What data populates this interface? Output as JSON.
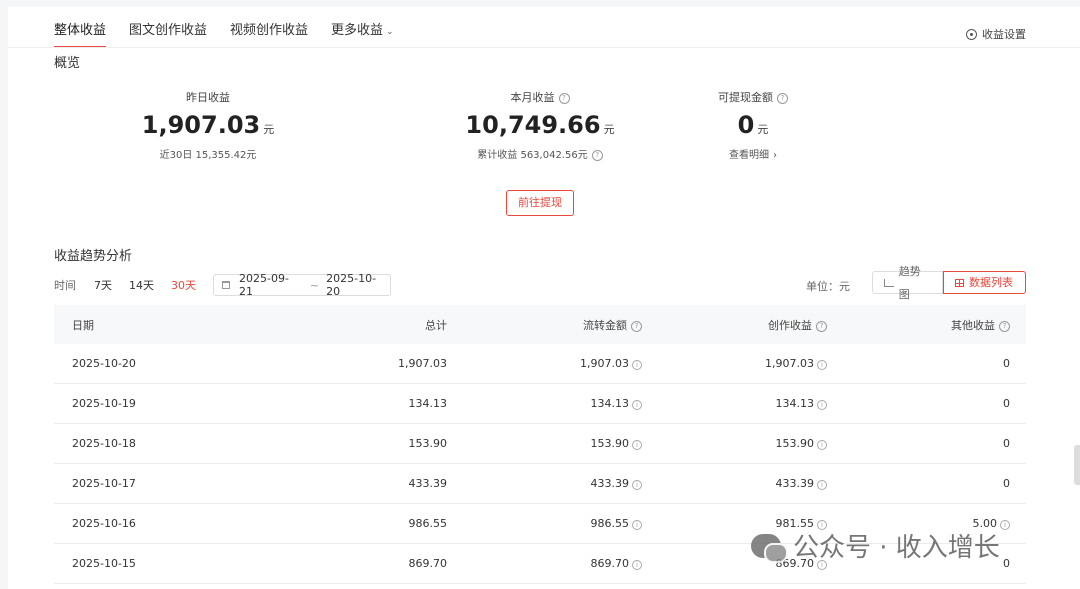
{
  "tabs": [
    {
      "label": "整体收益"
    },
    {
      "label": "图文创作收益"
    },
    {
      "label": "视频创作收益"
    },
    {
      "label": "更多收益"
    }
  ],
  "settings_label": "收益设置",
  "overview": {
    "title": "概览",
    "yesterday": {
      "label": "昨日收益",
      "value": "1,907.03",
      "unit": "元",
      "sub": "近30日 15,355.42元"
    },
    "month": {
      "label": "本月收益",
      "value": "10,749.66",
      "unit": "元",
      "sub": "累计收益 563,042.56元"
    },
    "withdrawable": {
      "label": "可提现金额",
      "value": "0",
      "unit": "元",
      "sub": "查看明细"
    },
    "withdraw_button": "前往提现"
  },
  "trend": {
    "title": "收益趋势分析",
    "time_label": "时间",
    "ranges": [
      "7天",
      "14天",
      "30天"
    ],
    "active_range": "30天",
    "date_start": "2025-09-21",
    "date_sep": "~",
    "date_end": "2025-10-20",
    "unit_label": "单位：元",
    "view_chart": "趋势图",
    "view_table": "数据列表"
  },
  "table": {
    "headers": {
      "date": "日期",
      "total": "总计",
      "flow": "流转金额",
      "creation": "创作收益",
      "other": "其他收益"
    },
    "rows": [
      {
        "date": "2025-10-20",
        "total": "1,907.03",
        "flow": "1,907.03",
        "creation": "1,907.03",
        "other": "0"
      },
      {
        "date": "2025-10-19",
        "total": "134.13",
        "flow": "134.13",
        "creation": "134.13",
        "other": "0"
      },
      {
        "date": "2025-10-18",
        "total": "153.90",
        "flow": "153.90",
        "creation": "153.90",
        "other": "0"
      },
      {
        "date": "2025-10-17",
        "total": "433.39",
        "flow": "433.39",
        "creation": "433.39",
        "other": "0"
      },
      {
        "date": "2025-10-16",
        "total": "986.55",
        "flow": "986.55",
        "creation": "981.55",
        "other": "5.00"
      },
      {
        "date": "2025-10-15",
        "total": "869.70",
        "flow": "869.70",
        "creation": "869.70",
        "other": "0"
      }
    ]
  },
  "watermark": "公众号 · 收入增长"
}
